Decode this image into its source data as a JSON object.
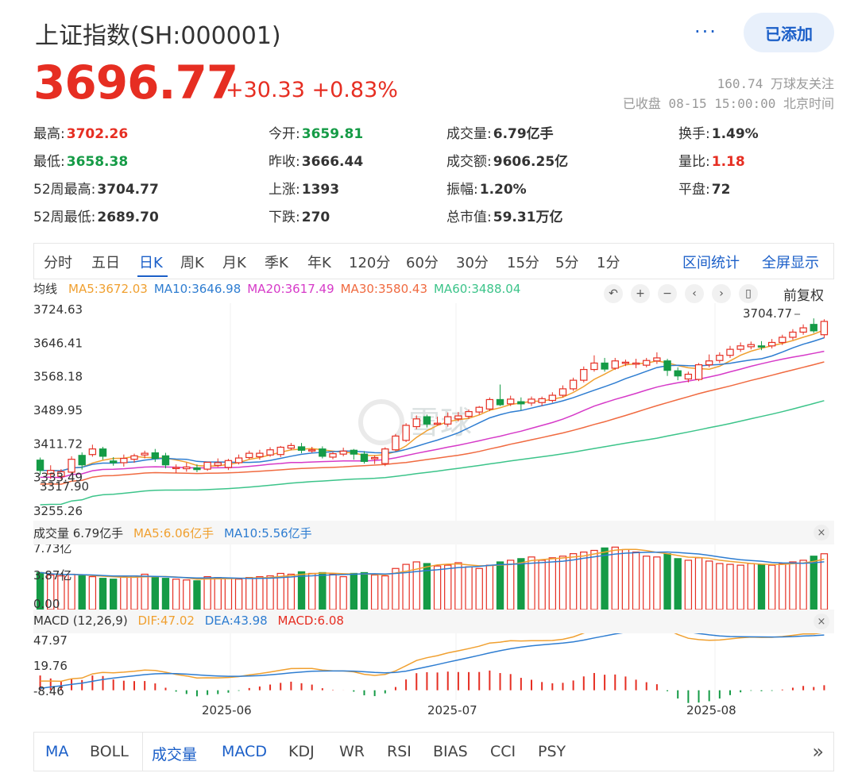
{
  "header": {
    "title": "上证指数(SH:000001)",
    "more": "···",
    "add_label": "已添加",
    "price": "3696.77",
    "change": "+30.33 +0.83%",
    "followers": "160.74 万球友关注",
    "status": "已收盘 08-15 15:00:00 北京时间"
  },
  "stats": [
    {
      "label": "最高:",
      "value": "3702.26",
      "tone": "red"
    },
    {
      "label": "今开:",
      "value": "3659.81",
      "tone": "green"
    },
    {
      "label": "成交量:",
      "value": "6.79亿手",
      "tone": ""
    },
    {
      "label": "换手:",
      "value": "1.49%",
      "tone": ""
    },
    {
      "label": "最低:",
      "value": "3658.38",
      "tone": "green"
    },
    {
      "label": "昨收:",
      "value": "3666.44",
      "tone": ""
    },
    {
      "label": "成交额:",
      "value": "9606.25亿",
      "tone": ""
    },
    {
      "label": "量比:",
      "value": "1.18",
      "tone": "red"
    },
    {
      "label": "52周最高:",
      "value": "3704.77",
      "tone": ""
    },
    {
      "label": "上涨:",
      "value": "1393",
      "tone": ""
    },
    {
      "label": "振幅:",
      "value": "1.20%",
      "tone": ""
    },
    {
      "label": "平盘:",
      "value": "72",
      "tone": ""
    },
    {
      "label": "52周最低:",
      "value": "2689.70",
      "tone": ""
    },
    {
      "label": "下跌:",
      "value": "270",
      "tone": ""
    },
    {
      "label": "总市值:",
      "value": "59.31万亿",
      "tone": ""
    }
  ],
  "period_tabs": [
    "分时",
    "五日",
    "日K",
    "周K",
    "月K",
    "季K",
    "年K",
    "120分",
    "60分",
    "30分",
    "15分",
    "5分",
    "1分"
  ],
  "active_period": "日K",
  "tab_actions": [
    "区间统计",
    "全屏显示"
  ],
  "ma_legend": {
    "label": "均线",
    "items": [
      {
        "text": "MA5:3672.03",
        "color": "#f0a030"
      },
      {
        "text": "MA10:3646.98",
        "color": "#2e7dd1"
      },
      {
        "text": "MA20:3617.49",
        "color": "#d63ac8"
      },
      {
        "text": "MA30:3580.43",
        "color": "#f06a40"
      },
      {
        "text": "MA60:3488.04",
        "color": "#3cc48a"
      }
    ]
  },
  "toolbar": {
    "tools": [
      "↶",
      "+",
      "−",
      "‹",
      "›",
      "▯"
    ],
    "adjust_label": "前复权"
  },
  "volume_legend": {
    "label": "成交量 6.79亿手",
    "ma5": "MA5:6.06亿手",
    "ma10": "MA10:5.56亿手"
  },
  "macd_legend": {
    "label": "MACD (12,26,9)",
    "dif": "DIF:47.02",
    "dea": "DEA:43.98",
    "macd": "MACD:6.08"
  },
  "close_glyph": "×",
  "watermark": "雪球",
  "bottom_tabs": [
    "MA",
    "BOLL",
    "成交量",
    "MACD",
    "KDJ",
    "WR",
    "RSI",
    "BIAS",
    "CCI",
    "PSY"
  ],
  "bottom_active": [
    "MA",
    "成交量",
    "MACD"
  ],
  "chevron": "»",
  "colors": {
    "up": "#e62e22",
    "down": "#159b46",
    "accent": "#1b5fc8"
  },
  "chart_data": {
    "type": "candlestick",
    "price_axis": {
      "ticks": [
        "3724.63",
        "3646.41",
        "3568.18",
        "3489.95",
        "3411.72",
        "3333.49",
        "3255.26"
      ],
      "range": [
        3255.26,
        3724.63
      ]
    },
    "annotations": {
      "high": "3704.77",
      "low": "3317.90"
    },
    "x_ticks": [
      "2025-06",
      "2025-07",
      "2025-08"
    ],
    "candles": [
      [
        3374,
        3350,
        3380,
        3340
      ],
      [
        3342,
        3350,
        3362,
        3330
      ],
      [
        3336,
        3347,
        3353,
        3330
      ],
      [
        3346,
        3376,
        3383,
        3342
      ],
      [
        3385,
        3363,
        3392,
        3352
      ],
      [
        3387,
        3400,
        3410,
        3382
      ],
      [
        3400,
        3383,
        3405,
        3375
      ],
      [
        3372,
        3368,
        3381,
        3361
      ],
      [
        3368,
        3378,
        3387,
        3359
      ],
      [
        3376,
        3384,
        3389,
        3368
      ],
      [
        3386,
        3390,
        3396,
        3378
      ],
      [
        3391,
        3378,
        3400,
        3370
      ],
      [
        3384,
        3363,
        3391,
        3355
      ],
      [
        3355,
        3357,
        3364,
        3344
      ],
      [
        3354,
        3358,
        3368,
        3347
      ],
      [
        3356,
        3352,
        3364,
        3346
      ],
      [
        3353,
        3369,
        3370,
        3349
      ],
      [
        3362,
        3368,
        3378,
        3358
      ],
      [
        3357,
        3373,
        3377,
        3351
      ],
      [
        3368,
        3379,
        3387,
        3364
      ],
      [
        3380,
        3390,
        3396,
        3376
      ],
      [
        3382,
        3390,
        3398,
        3375
      ],
      [
        3386,
        3398,
        3404,
        3382
      ],
      [
        3387,
        3404,
        3407,
        3381
      ],
      [
        3402,
        3408,
        3414,
        3397
      ],
      [
        3405,
        3397,
        3414,
        3390
      ],
      [
        3396,
        3398,
        3405,
        3391
      ],
      [
        3400,
        3383,
        3406,
        3378
      ],
      [
        3381,
        3389,
        3393,
        3376
      ],
      [
        3388,
        3395,
        3403,
        3383
      ],
      [
        3397,
        3388,
        3400,
        3375
      ],
      [
        3388,
        3371,
        3395,
        3366
      ],
      [
        3377,
        3380,
        3385,
        3365
      ],
      [
        3366,
        3400,
        3404,
        3360
      ],
      [
        3398,
        3430,
        3435,
        3395
      ],
      [
        3420,
        3455,
        3460,
        3416
      ],
      [
        3452,
        3470,
        3478,
        3446
      ],
      [
        3475,
        3458,
        3480,
        3450
      ],
      [
        3458,
        3460,
        3475,
        3455
      ],
      [
        3458,
        3475,
        3485,
        3452
      ],
      [
        3470,
        3477,
        3486,
        3464
      ],
      [
        3476,
        3487,
        3492,
        3470
      ],
      [
        3486,
        3497,
        3500,
        3480
      ],
      [
        3493,
        3515,
        3520,
        3488
      ],
      [
        3515,
        3503,
        3550,
        3500
      ],
      [
        3505,
        3516,
        3524,
        3500
      ],
      [
        3510,
        3505,
        3520,
        3490
      ],
      [
        3507,
        3516,
        3522,
        3500
      ],
      [
        3508,
        3517,
        3522,
        3500
      ],
      [
        3513,
        3525,
        3532,
        3508
      ],
      [
        3525,
        3540,
        3548,
        3520
      ],
      [
        3540,
        3560,
        3566,
        3535
      ],
      [
        3560,
        3585,
        3592,
        3555
      ],
      [
        3585,
        3600,
        3618,
        3580
      ],
      [
        3600,
        3586,
        3612,
        3580
      ],
      [
        3588,
        3605,
        3612,
        3584
      ],
      [
        3600,
        3602,
        3608,
        3593
      ],
      [
        3600,
        3600,
        3610,
        3588
      ],
      [
        3595,
        3606,
        3612,
        3590
      ],
      [
        3605,
        3612,
        3625,
        3598
      ],
      [
        3605,
        3583,
        3610,
        3570
      ],
      [
        3582,
        3570,
        3590,
        3560
      ],
      [
        3563,
        3574,
        3580,
        3555
      ],
      [
        3562,
        3596,
        3600,
        3558
      ],
      [
        3596,
        3605,
        3620,
        3590
      ],
      [
        3606,
        3618,
        3625,
        3600
      ],
      [
        3618,
        3632,
        3640,
        3612
      ],
      [
        3632,
        3640,
        3648,
        3626
      ],
      [
        3638,
        3643,
        3650,
        3632
      ],
      [
        3640,
        3639,
        3651,
        3630
      ],
      [
        3640,
        3648,
        3656,
        3634
      ],
      [
        3648,
        3660,
        3666,
        3642
      ],
      [
        3660,
        3672,
        3679,
        3654
      ],
      [
        3672,
        3682,
        3690,
        3666
      ],
      [
        3690,
        3675,
        3704,
        3670
      ],
      [
        3666,
        3697,
        3702,
        3658
      ]
    ],
    "volume_axis": {
      "ticks": [
        "7.73亿",
        "3.87亿",
        "0.00"
      ],
      "range": [
        0,
        7.73
      ]
    },
    "volume": [
      4.5,
      4.2,
      4.1,
      4.3,
      4.1,
      4.0,
      3.8,
      3.7,
      4.0,
      4.1,
      4.3,
      3.9,
      3.8,
      3.7,
      3.6,
      3.5,
      4.0,
      3.9,
      3.8,
      3.7,
      3.9,
      4.0,
      4.1,
      4.4,
      4.3,
      4.6,
      4.4,
      4.5,
      4.3,
      4.0,
      4.4,
      4.5,
      4.2,
      4.1,
      5.0,
      5.5,
      5.8,
      5.6,
      5.3,
      5.4,
      5.7,
      5.2,
      5.0,
      5.4,
      5.8,
      6.0,
      6.2,
      6.4,
      6.0,
      6.3,
      6.5,
      6.8,
      7.0,
      7.2,
      7.5,
      7.6,
      7.3,
      7.0,
      6.5,
      6.4,
      6.8,
      6.2,
      6.0,
      6.3,
      5.9,
      5.6,
      5.5,
      5.4,
      5.6,
      5.5,
      5.4,
      5.6,
      5.8,
      6.0,
      6.5,
      6.79
    ],
    "macd_axis": {
      "ticks": [
        "47.97",
        "19.76",
        "-8.46"
      ],
      "range": [
        -8.46,
        47.97
      ]
    }
  }
}
